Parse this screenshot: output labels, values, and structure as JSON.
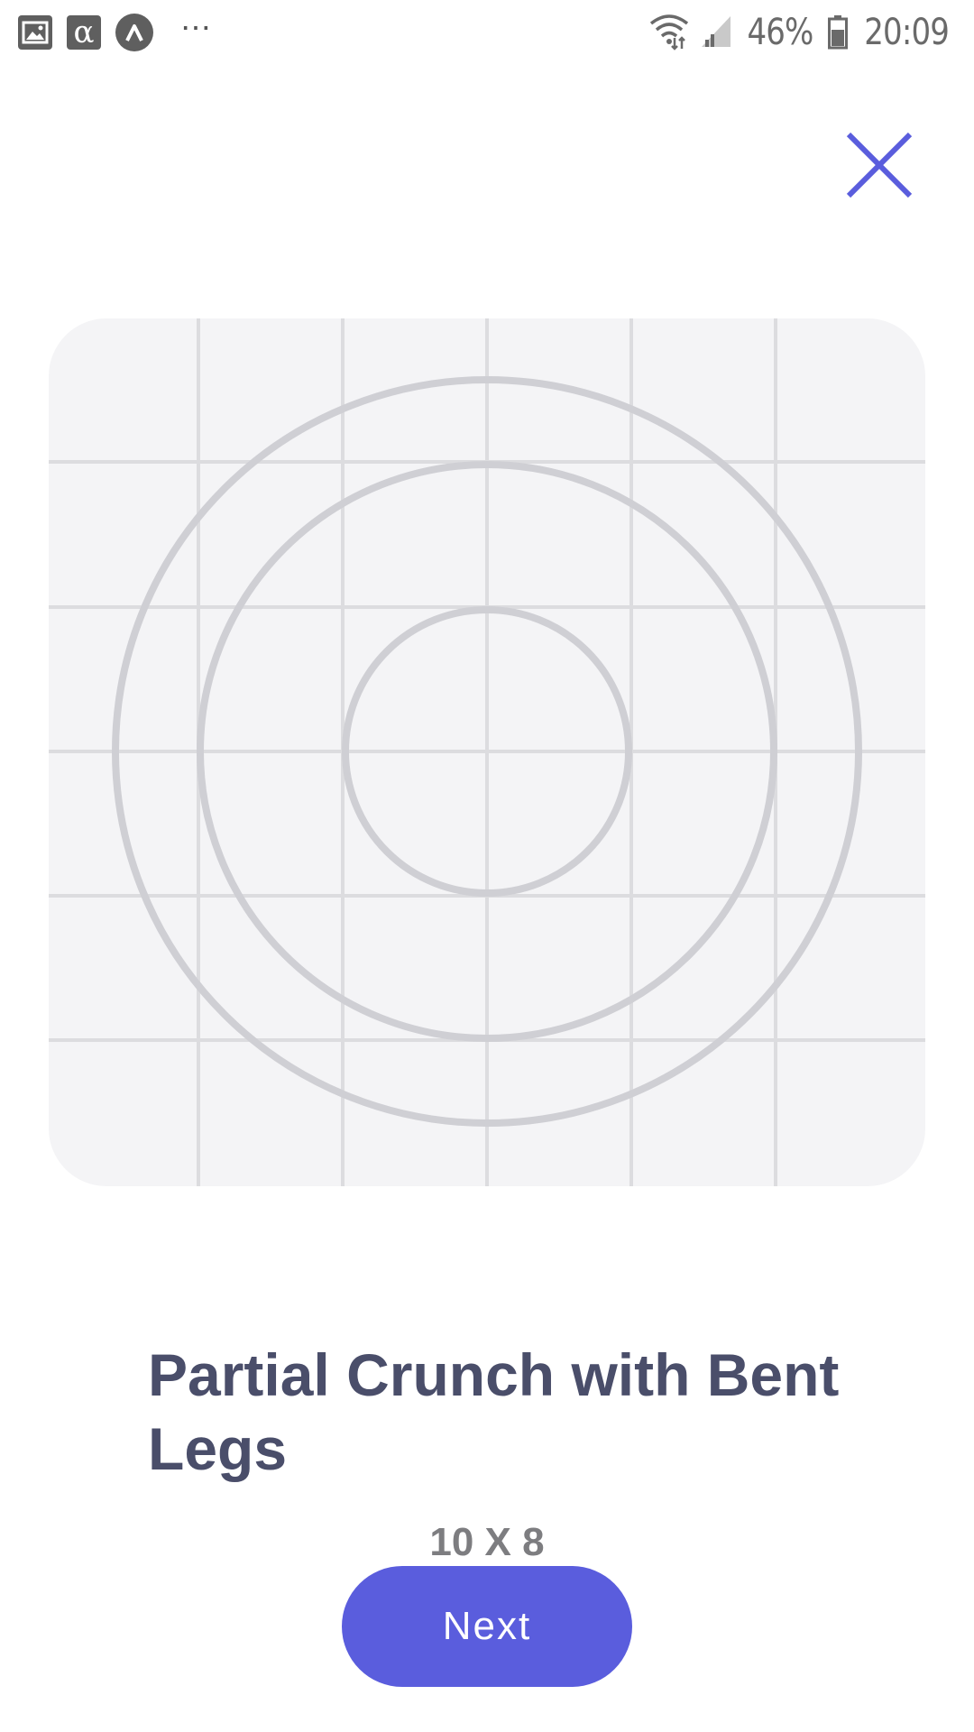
{
  "status_bar": {
    "icons": [
      "gallery-icon",
      "alpha-icon",
      "circle-a-icon",
      "more-dots-icon",
      "wifi-icon",
      "signal-icon",
      "battery-icon"
    ],
    "more": "⋯",
    "alpha": "α",
    "battery": "46%",
    "time": "20:09"
  },
  "header": {
    "close_icon": "close-icon",
    "accent_color": "#5a5ddd"
  },
  "illustration": {
    "type": "placeholder-grid-with-concentric-circles"
  },
  "exercise": {
    "title": "Partial Crunch with Bent Legs",
    "reps": "10 X 8"
  },
  "actions": {
    "next_label": "Next"
  }
}
